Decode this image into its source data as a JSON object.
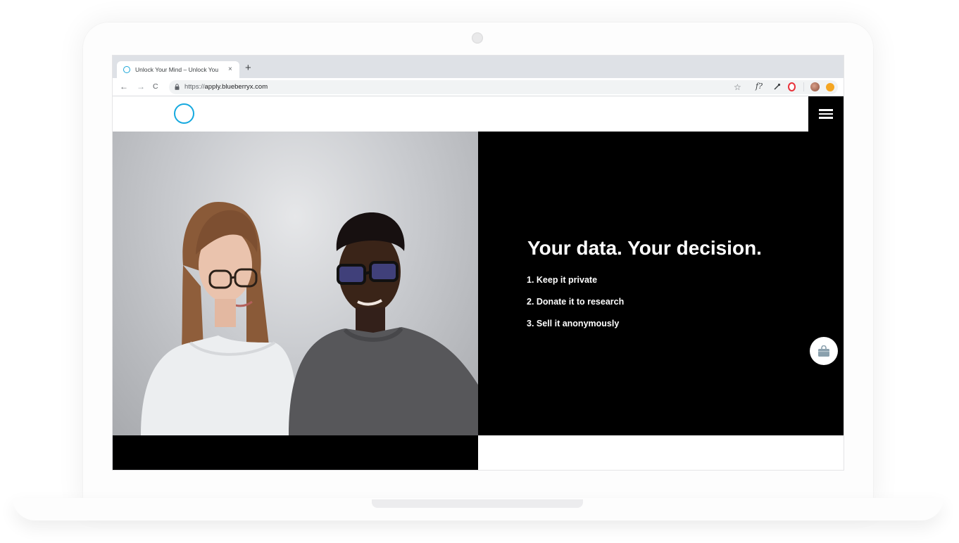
{
  "browser": {
    "tab_title": "Unlock Your Mind – Unlock You",
    "tab_close": "×",
    "new_tab": "+",
    "back": "←",
    "forward": "→",
    "reload": "C",
    "url_scheme": "https://",
    "url_host": "apply.blueberryx.com",
    "star": "☆",
    "ext_font": "f?",
    "ext_dropper": "⁄"
  },
  "page": {
    "headline": "Your data. Your decision.",
    "options": [
      "1. Keep it private",
      "2. Donate it to research",
      "3. Sell it anonymously"
    ]
  },
  "colors": {
    "brand": "#15a9df",
    "hero_bg": "#000000"
  },
  "icons": [
    "lock-icon",
    "star-icon",
    "menu-icon",
    "shopping-bag-icon",
    "logo-icon"
  ]
}
